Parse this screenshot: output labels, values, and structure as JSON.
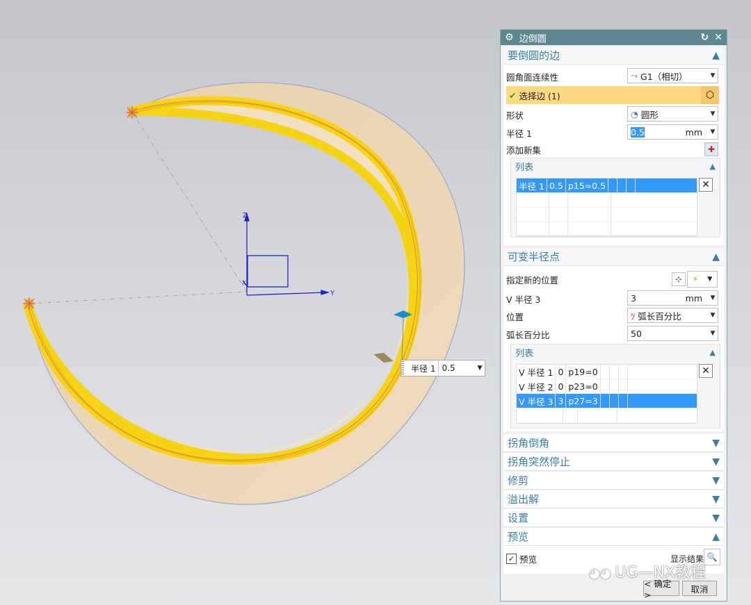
{
  "viewport": {
    "axis_z": "Z",
    "axis_y": "Y",
    "axis_x": "X",
    "mini_field": {
      "label": "半径 1",
      "value": "0.5"
    }
  },
  "dialog": {
    "title": "边倒圆",
    "sections": {
      "edges": {
        "title": "要倒圆的边",
        "continuity_label": "圆角面连续性",
        "continuity_value": "G1（相切）",
        "select_edge_label": "选择边 (1)",
        "shape_label": "形状",
        "shape_value": "圆形",
        "radius_label": "半径 1",
        "radius_value": "0.5",
        "radius_unit": "mm",
        "add_new_set_label": "添加新集",
        "list_title": "列表",
        "list_rows": [
          {
            "c1": "半径 1",
            "c2": "0.5",
            "c3": "p15=0.5"
          }
        ]
      },
      "var_radius": {
        "title": "可变半径点",
        "specify_location_label": "指定新的位置",
        "v_radius_label": "V 半径 3",
        "v_radius_value": "3",
        "v_radius_unit": "mm",
        "position_label": "位置",
        "position_value": "弧长百分比",
        "arc_pct_label": "弧长百分比",
        "arc_pct_value": "50",
        "list_title": "列表",
        "list_rows": [
          {
            "c1": "V 半径 1",
            "c2": "0",
            "c3": "p19=0"
          },
          {
            "c1": "V 半径 2",
            "c2": "0",
            "c3": "p23=0"
          },
          {
            "c1": "V 半径 3",
            "c2": "3",
            "c3": "p27=3"
          }
        ]
      },
      "corner_chamfer": {
        "title": "拐角倒角"
      },
      "corner_stop": {
        "title": "拐角突然停止"
      },
      "trim": {
        "title": "修剪"
      },
      "overflow": {
        "title": "溢出解"
      },
      "settings": {
        "title": "设置"
      },
      "preview": {
        "title": "预览",
        "preview_check_label": "预览",
        "show_result_label": "显示结果"
      }
    },
    "ok_label": "< 确定 >",
    "cancel_label": "取消"
  },
  "watermark": "UG—NX教程",
  "colors": {
    "title_bar": "#5e8891",
    "section_title": "#3b7ea1",
    "selection": "#3399ff",
    "select_edge_bg": "#fdd983",
    "fillet_yellow": "#f5d315",
    "body_tan": "#ecd6b4"
  }
}
